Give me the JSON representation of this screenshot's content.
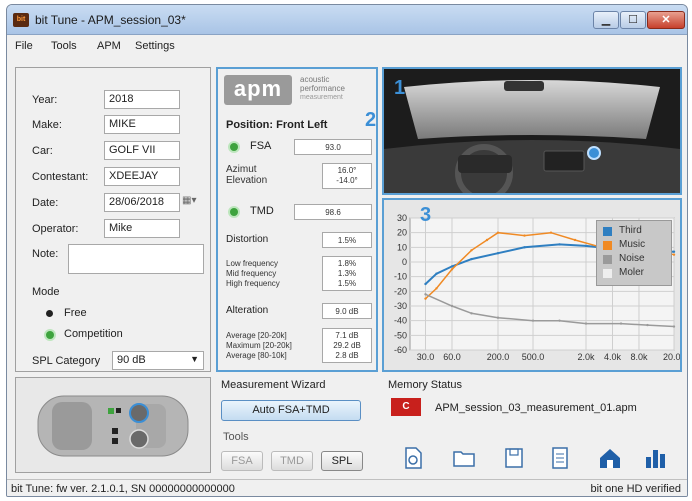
{
  "window": {
    "title": "bit Tune - APM_session_03*",
    "icon_text": "bit",
    "controls": [
      "minimize",
      "maximize",
      "close"
    ]
  },
  "menu": [
    "File",
    "Tools",
    "APM",
    "Settings"
  ],
  "form": {
    "fields": [
      {
        "label": "Year:",
        "value": "2018"
      },
      {
        "label": "Make:",
        "value": "MIKE"
      },
      {
        "label": "Car:",
        "value": "GOLF VII"
      },
      {
        "label": "Contestant:",
        "value": "XDEEJAY"
      },
      {
        "label": "Date:",
        "value": "28/06/2018"
      },
      {
        "label": "Operator:",
        "value": "Mike"
      },
      {
        "label": "Note:",
        "value": ""
      }
    ]
  },
  "mode": {
    "label": "Mode",
    "options": [
      {
        "label": "Free",
        "selected": false
      },
      {
        "label": "Competition",
        "selected": true
      }
    ],
    "spl_label": "SPL Category",
    "spl_value": "90 dB"
  },
  "apm": {
    "logo_text": "apm",
    "logo_sub1": "acoustic",
    "logo_sub2": "performance",
    "logo_sub3": "measurement",
    "position": "Position: Front Left",
    "fsa_label": "FSA",
    "fsa_value": "93.0",
    "azimut_label": "Azimut",
    "elevation_label": "Elevation",
    "azimut_value": "16.0°",
    "elevation_value": "-14.0°",
    "tmd_label": "TMD",
    "tmd_value": "98.6",
    "distortion_label": "Distortion",
    "distortion_value": "1.5%",
    "freq_labels": [
      "Low frequency",
      "Mid frequency",
      "High frequency"
    ],
    "freq_values": [
      "1.8%",
      "1.3%",
      "1.5%"
    ],
    "alteration_label": "Alteration",
    "alteration_value": "9.0 dB",
    "avg_labels": [
      "Average [20-20k]",
      "Maximum [20-20k]",
      "Average [80-10k]"
    ],
    "avg_values": [
      "7.1 dB",
      "29.2 dB",
      "2.8 dB"
    ]
  },
  "callouts": [
    "1",
    "2",
    "3"
  ],
  "wizard": {
    "label": "Measurement Wizard",
    "button": "Auto FSA+TMD",
    "tools_label": "Tools",
    "tools": [
      "FSA",
      "TMD",
      "SPL"
    ]
  },
  "memory": {
    "label": "Memory Status",
    "badge": "C",
    "file": "APM_session_03_measurement_01.apm",
    "icons": [
      "open-file-icon",
      "folder-icon",
      "save-icon",
      "document-icon",
      "home-save-icon",
      "levels-icon"
    ]
  },
  "status": {
    "left": "bit Tune: fw ver. 2.1.0.1, SN 00000000000000",
    "right": "bit one HD verified"
  },
  "chart_data": {
    "type": "line",
    "yticks": [
      "30",
      "20",
      "10",
      "0",
      "-10",
      "-20",
      "-30",
      "-40",
      "-50",
      "-60"
    ],
    "xticks": [
      "30.0",
      "60.0",
      "200.0",
      "500.0",
      "2.0k",
      "4.0k",
      "8.0k",
      "20.0k"
    ],
    "ylim": [
      -60,
      30
    ],
    "xscale": "log",
    "grid": true,
    "legend": [
      {
        "name": "Third",
        "color": "#2f7fc1"
      },
      {
        "name": "Music",
        "color": "#f08a24"
      },
      {
        "name": "Noise",
        "color": "#9a9a9a"
      },
      {
        "name": "Moler",
        "color": "#e0e0e0"
      }
    ],
    "legend_position": "top-right",
    "series": [
      {
        "name": "Third",
        "x": [
          30,
          40,
          60,
          100,
          200,
          400,
          1000,
          2000,
          4000,
          8000,
          20000
        ],
        "y": [
          -15,
          -8,
          -3,
          2,
          6,
          10,
          12,
          11,
          9,
          8,
          7
        ]
      },
      {
        "name": "Music",
        "x": [
          30,
          40,
          60,
          100,
          150,
          200,
          400,
          800,
          1500,
          3000,
          6000,
          12000,
          20000
        ],
        "y": [
          -25,
          -18,
          -5,
          8,
          15,
          20,
          18,
          20,
          15,
          10,
          12,
          8,
          5
        ]
      },
      {
        "name": "Noise",
        "x": [
          30,
          60,
          100,
          200,
          500,
          1000,
          2000,
          5000,
          10000,
          20000
        ],
        "y": [
          -22,
          -30,
          -35,
          -38,
          -40,
          -40,
          -42,
          -42,
          -43,
          -44
        ]
      }
    ]
  }
}
